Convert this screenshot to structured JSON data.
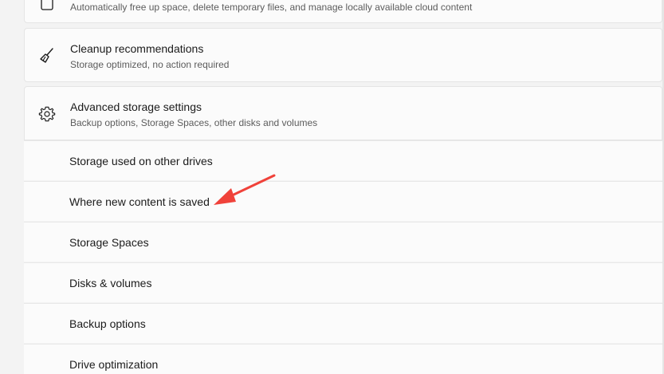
{
  "storage_sense": {
    "description": "Automatically free up space, delete temporary files, and manage locally available cloud content"
  },
  "cleanup": {
    "title": "Cleanup recommendations",
    "subtitle": "Storage optimized, no action required",
    "icon": "broom-icon"
  },
  "advanced": {
    "title": "Advanced storage settings",
    "subtitle": "Backup options, Storage Spaces, other disks and volumes",
    "icon": "gear-icon",
    "items": [
      {
        "label": "Storage used on other drives"
      },
      {
        "label": "Where new content is saved"
      },
      {
        "label": "Storage Spaces"
      },
      {
        "label": "Disks & volumes"
      },
      {
        "label": "Backup options"
      },
      {
        "label": "Drive optimization"
      }
    ]
  },
  "annotation": {
    "color": "#f0423a",
    "icon": "arrow-pointer"
  }
}
